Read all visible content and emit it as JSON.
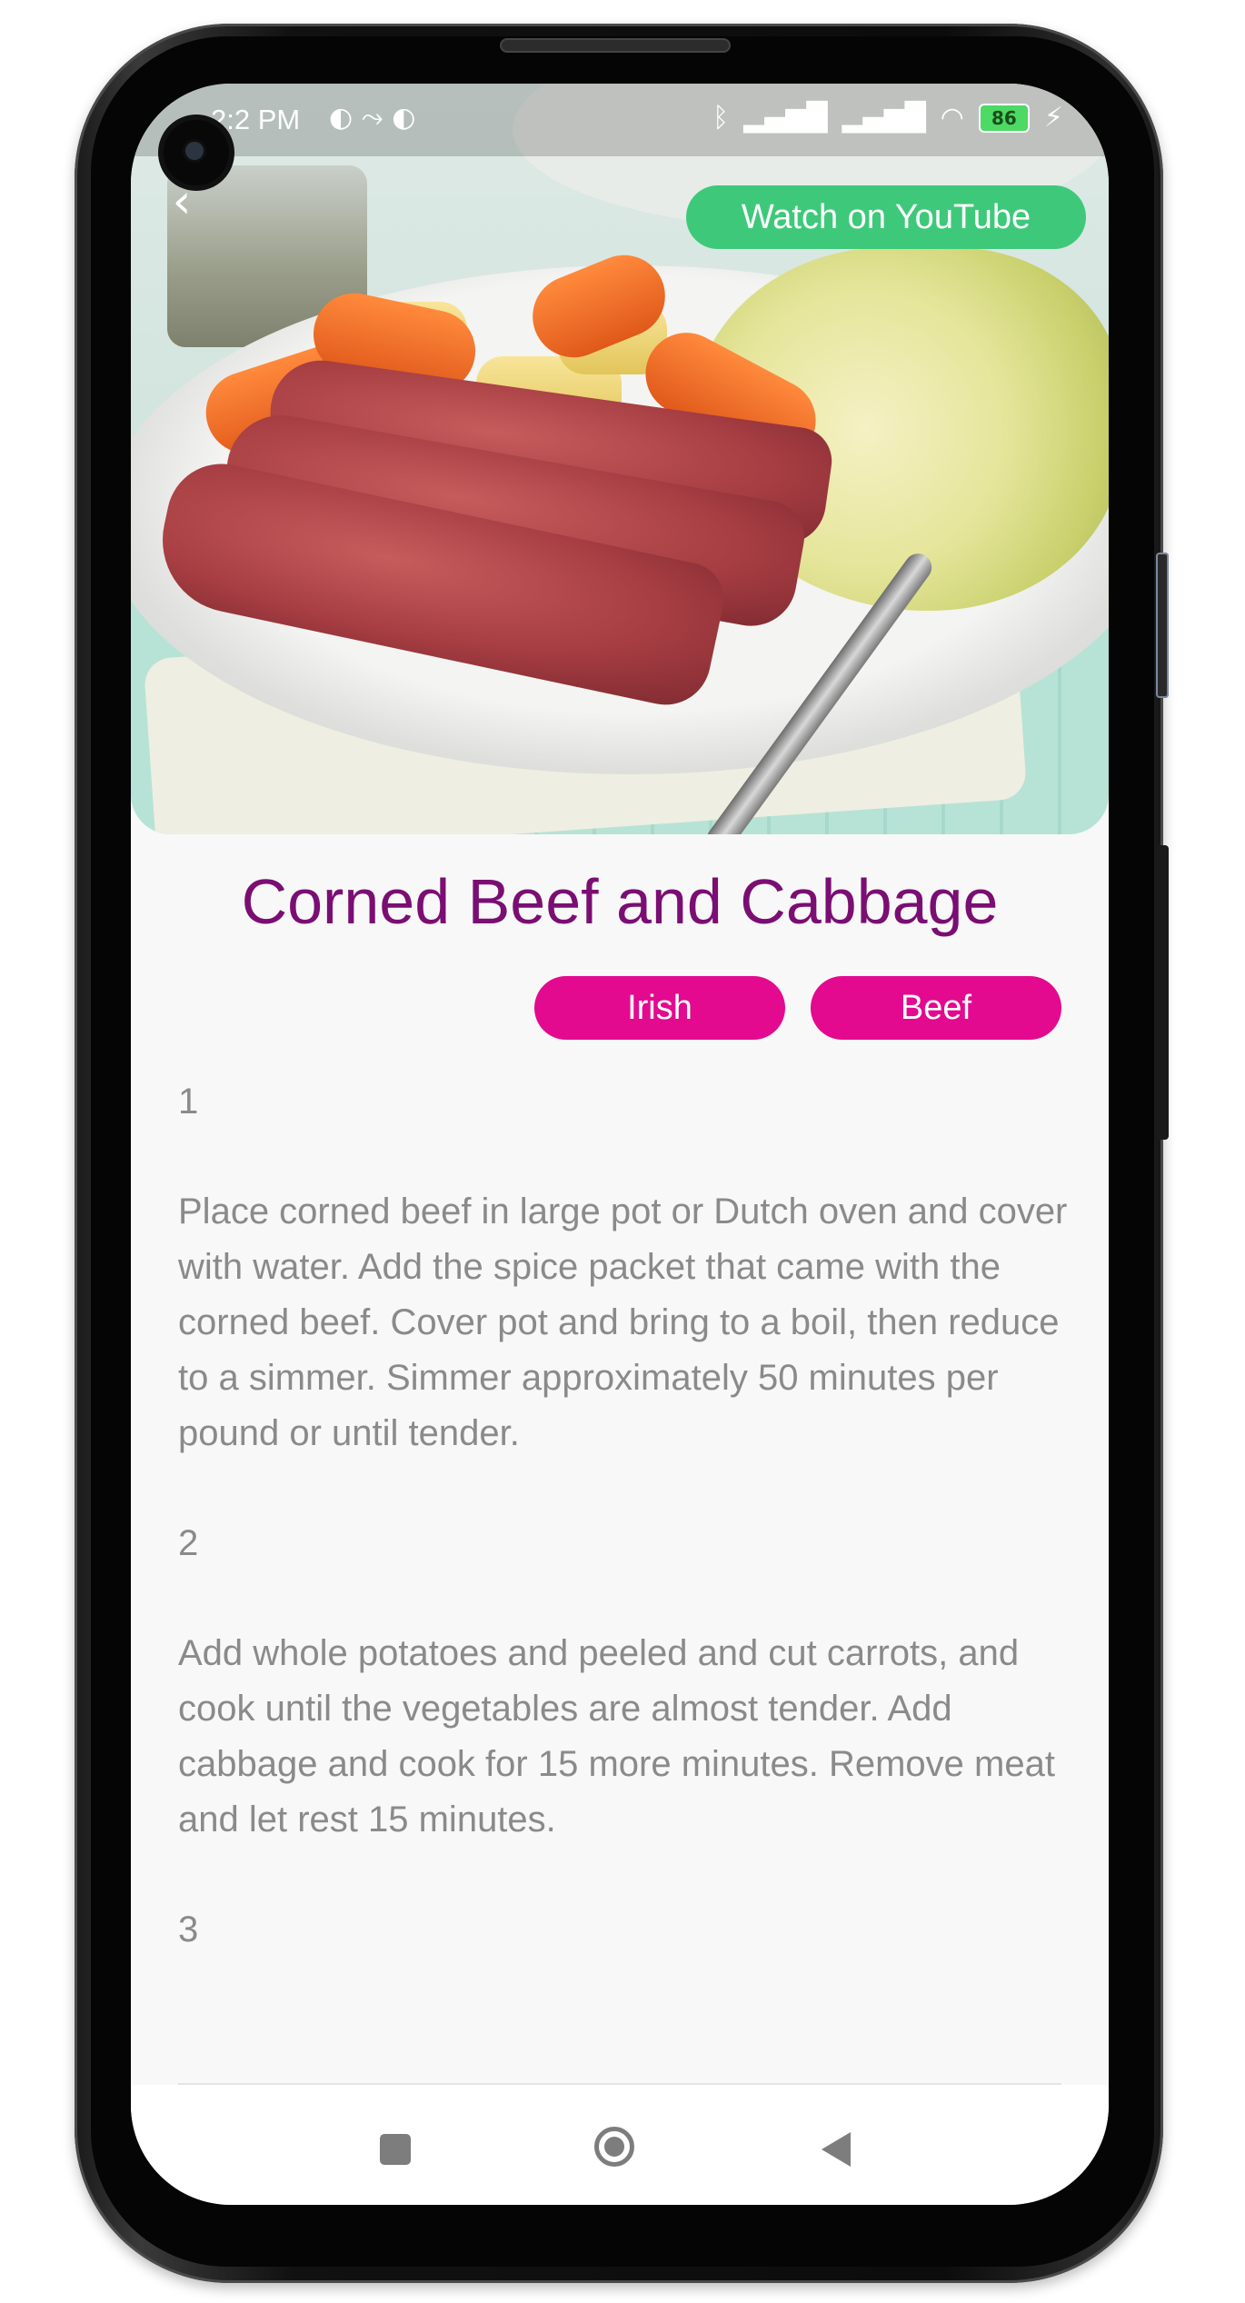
{
  "status_bar": {
    "time": "2:2 PM",
    "left_icons": [
      "notification-icon",
      "notification-icon",
      "notification-icon"
    ],
    "right_icons": [
      "bluetooth-icon",
      "signal-icon",
      "signal-icon",
      "wifi-icon"
    ],
    "battery_level": "86",
    "charging": true
  },
  "header": {
    "back_glyph": "‹",
    "youtube_label": "Watch on YouTube",
    "youtube_color": "#3ec97a"
  },
  "meal": {
    "title": "Corned Beef and Cabbage",
    "title_color": "#7a0e73",
    "tags": [
      "Irish",
      "Beef"
    ],
    "tag_color": "#e30a8f"
  },
  "instructions": {
    "steps": [
      {
        "number": "1",
        "text": "Place corned beef in large pot or Dutch oven and cover with water. Add the spice packet that came with the corned beef. Cover pot and bring to a boil, then reduce to a simmer. Simmer approximately 50 minutes per pound or until tender."
      },
      {
        "number": "2",
        "text": "Add whole potatoes and peeled and cut carrots, and cook until the vegetables are almost tender. Add cabbage and cook for 15 more minutes. Remove meat and let rest 15 minutes."
      },
      {
        "number": "3",
        "text": ""
      }
    ]
  },
  "nav_bar": {
    "buttons": [
      "recents-button",
      "home-button",
      "back-button"
    ]
  }
}
